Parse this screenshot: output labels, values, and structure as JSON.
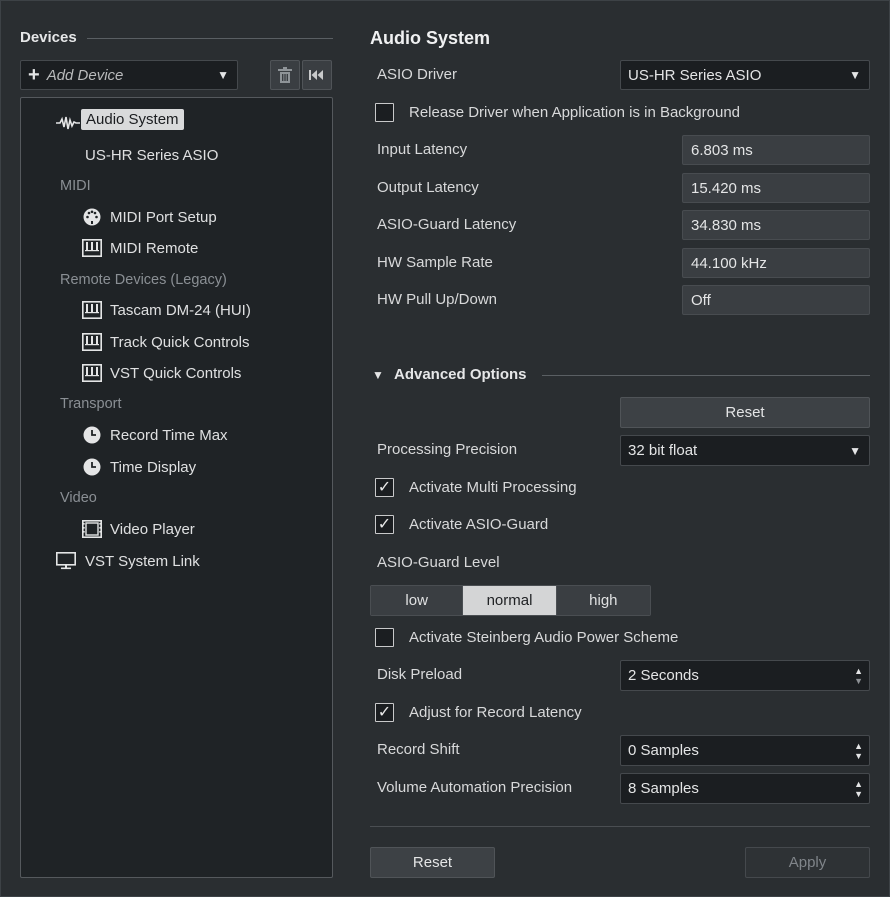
{
  "sidebar": {
    "title": "Devices",
    "add_device_label": "Add Device",
    "tree": {
      "audio_system": "Audio System",
      "us_hr": "US-HR Series ASIO",
      "midi": "MIDI",
      "midi_port_setup": "MIDI Port Setup",
      "midi_remote": "MIDI Remote",
      "remote_legacy": "Remote Devices (Legacy)",
      "tascam": "Tascam DM-24 (HUI)",
      "track_quick": "Track Quick Controls",
      "vst_quick": "VST Quick Controls",
      "transport": "Transport",
      "record_time_max": "Record Time Max",
      "time_display": "Time Display",
      "video": "Video",
      "video_player": "Video Player",
      "vst_system_link": "VST System Link"
    }
  },
  "main": {
    "title": "Audio System",
    "asio_driver_label": "ASIO Driver",
    "asio_driver_value": "US-HR Series ASIO",
    "release_driver_label": "Release Driver when Application is in Background",
    "release_driver_checked": false,
    "input_latency_label": "Input Latency",
    "input_latency_value": "6.803 ms",
    "output_latency_label": "Output Latency",
    "output_latency_value": "15.420 ms",
    "asio_guard_latency_label": "ASIO-Guard Latency",
    "asio_guard_latency_value": "34.830 ms",
    "hw_sample_rate_label": "HW Sample Rate",
    "hw_sample_rate_value": "44.100 kHz",
    "hw_pull_label": "HW Pull Up/Down",
    "hw_pull_value": "Off",
    "advanced_label": "Advanced Options",
    "advanced_reset_label": "Reset",
    "processing_precision_label": "Processing Precision",
    "processing_precision_value": "32 bit float",
    "multi_processing_label": "Activate Multi Processing",
    "multi_processing_checked": true,
    "asio_guard_label": "Activate ASIO-Guard",
    "asio_guard_checked": true,
    "asio_guard_level_label": "ASIO-Guard Level",
    "levels": [
      "low",
      "normal",
      "high"
    ],
    "level_selected": "normal",
    "power_scheme_label": "Activate Steinberg Audio Power Scheme",
    "power_scheme_checked": false,
    "disk_preload_label": "Disk Preload",
    "disk_preload_value": "2 Seconds",
    "adjust_latency_label": "Adjust for Record Latency",
    "adjust_latency_checked": true,
    "record_shift_label": "Record Shift",
    "record_shift_value": "0 Samples",
    "volume_precision_label": "Volume Automation Precision",
    "volume_precision_value": "8 Samples"
  },
  "footer": {
    "reset_label": "Reset",
    "apply_label": "Apply"
  },
  "checkmark": "✓"
}
